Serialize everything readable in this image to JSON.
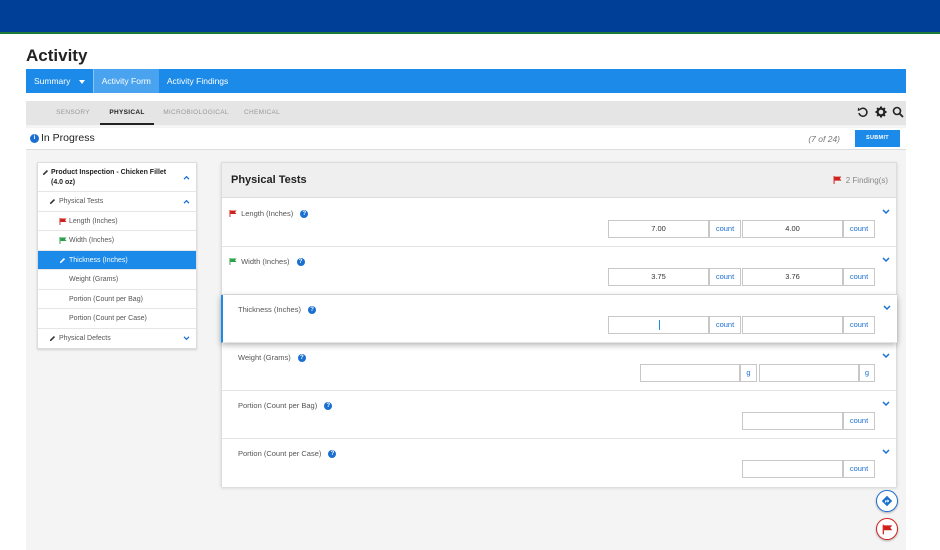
{
  "page": {
    "title": "Activity"
  },
  "nav": [
    {
      "label": "Summary"
    },
    {
      "label": "Activity Form"
    },
    {
      "label": "Activity Findings"
    }
  ],
  "tabs": [
    {
      "label": "SENSORY"
    },
    {
      "label": "PHYSICAL"
    },
    {
      "label": "MICROBIOLOGICAL"
    },
    {
      "label": "CHEMICAL"
    }
  ],
  "toolbar_icons": [
    "refresh-icon",
    "gear-icon",
    "search-icon"
  ],
  "status": {
    "icon": "info-icon",
    "text": "In Progress",
    "count": "(7 of 24)",
    "submit_label": "SUBMIT"
  },
  "tree": {
    "root": "Product Inspection - Chicken Fillet (4.0 oz)",
    "group1": "Physical Tests",
    "items": [
      {
        "label": "Length (Inches)",
        "flag": "red"
      },
      {
        "label": "Width (Inches)",
        "flag": "green"
      },
      {
        "label": "Thickness (Inches)",
        "selected": true
      },
      {
        "label": "Weight (Grams)"
      },
      {
        "label": "Portion (Count per Bag)"
      },
      {
        "label": "Portion (Count per Case)"
      }
    ],
    "group2": "Physical Defects"
  },
  "panel": {
    "title": "Physical Tests",
    "findings": "2 Finding(s)",
    "rows": [
      {
        "label": "Length (Inches)",
        "flag": "red",
        "fields": [
          {
            "value": "7.00",
            "unit": "count"
          },
          {
            "value": "4.00",
            "unit": "count"
          }
        ]
      },
      {
        "label": "Width (Inches)",
        "flag": "green",
        "fields": [
          {
            "value": "3.75",
            "unit": "count"
          },
          {
            "value": "3.76",
            "unit": "count"
          }
        ]
      },
      {
        "label": "Thickness (Inches)",
        "focused": true,
        "fields": [
          {
            "value": "",
            "unit": "count"
          },
          {
            "value": "",
            "unit": "count"
          }
        ]
      },
      {
        "label": "Weight (Grams)",
        "fields": [
          {
            "value": "",
            "unit": "g"
          },
          {
            "value": "",
            "unit": "g"
          }
        ]
      },
      {
        "label": "Portion (Count per Bag)",
        "fields": [
          {
            "value": "",
            "unit": "count"
          }
        ]
      },
      {
        "label": "Portion (Count per Case)",
        "fields": [
          {
            "value": "",
            "unit": "count"
          }
        ]
      }
    ]
  },
  "colors": {
    "brand": "#003f97",
    "accent": "#1b8ae8",
    "flag_red": "#d0201c",
    "flag_green": "#2aa14a"
  }
}
